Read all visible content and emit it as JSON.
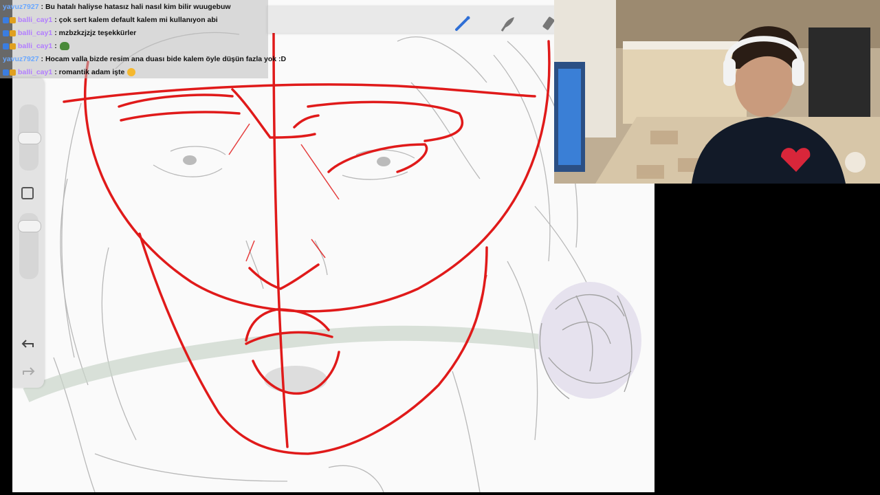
{
  "chat": {
    "messages": [
      {
        "user": "yavuz7927",
        "user_color": "#6aa8ff",
        "text": ": Bu hatalı haliyse hatasız hali nasıl kim bilir wuugebuw",
        "badges": false
      },
      {
        "user": "balli_cay1",
        "user_color": "#b27dff",
        "text": ": çok sert kalem default kalem mi kullanıyon abi",
        "badges": true
      },
      {
        "user": "balli_cay1",
        "user_color": "#b27dff",
        "text": ": mzbzkzjzjz teşekkürler",
        "badges": true
      },
      {
        "user": "balli_cay1",
        "user_color": "#b27dff",
        "text": ":",
        "badges": true,
        "emote": "pepe-emote"
      },
      {
        "user": "yavuz7927",
        "user_color": "#6aa8ff",
        "text": ": Hocam valla bizde resim ana duası bide kalem öyle düşün fazla yok :D",
        "badges": false
      },
      {
        "user": "balli_cay1",
        "user_color": "#b27dff",
        "text": ": romantik adam işte",
        "badges": true,
        "emote": "heart-eyes-emote"
      }
    ]
  },
  "toolbar": {
    "tools": [
      "brush-icon",
      "smudge-icon",
      "eraser-icon"
    ],
    "active_color": "#2f6fd6"
  },
  "sidebar": {
    "icons": [
      "size-slider",
      "color-square-icon",
      "opacity-slider",
      "undo-icon",
      "redo-icon"
    ]
  },
  "colors": {
    "sketch_red": "#e01a1a",
    "pencil_gray": "#9a9a9a",
    "rose_purple": "#c9c2dd"
  }
}
